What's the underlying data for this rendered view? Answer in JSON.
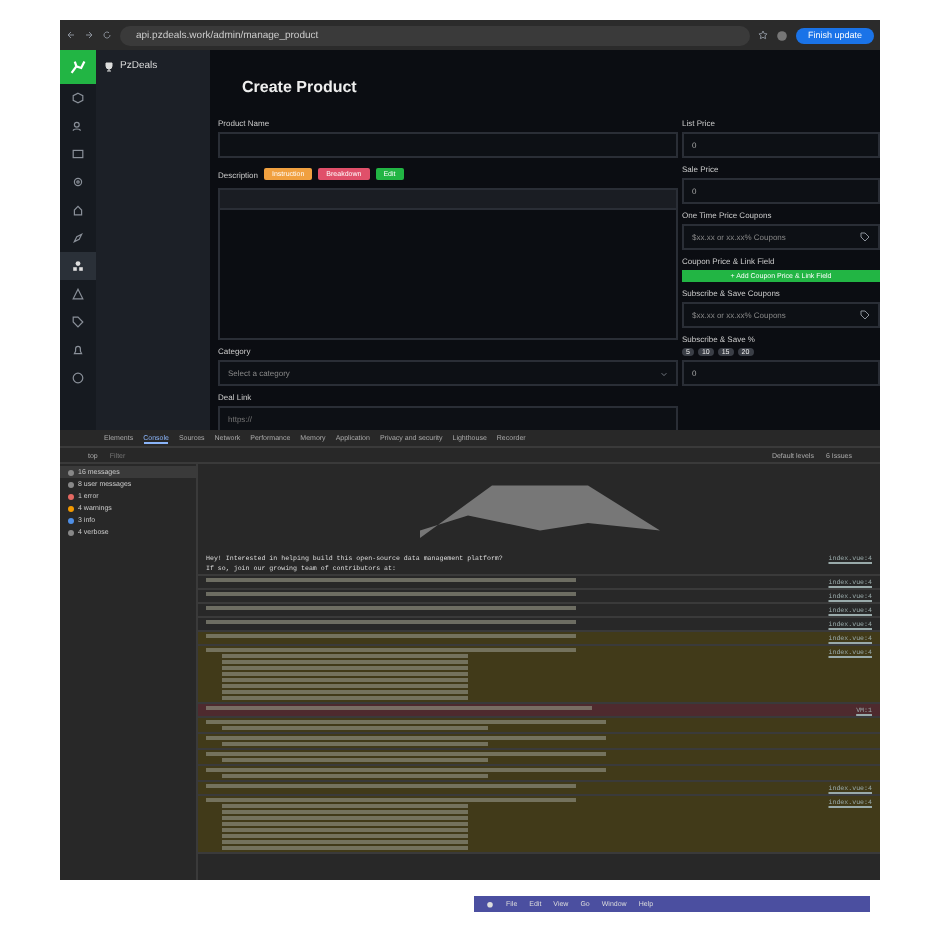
{
  "browser": {
    "url": "api.pzdeals.work/admin/manage_product",
    "update_button": "Finish update"
  },
  "rail": [
    {
      "kind": "box",
      "selected": false
    },
    {
      "kind": "users",
      "selected": false
    },
    {
      "kind": "folder",
      "selected": false
    },
    {
      "kind": "gear",
      "selected": false
    },
    {
      "kind": "home",
      "selected": false
    },
    {
      "kind": "rocket",
      "selected": false
    },
    {
      "kind": "shapes",
      "selected": true
    },
    {
      "kind": "warning",
      "selected": false
    },
    {
      "kind": "tag",
      "selected": false
    },
    {
      "kind": "bell",
      "selected": false
    },
    {
      "kind": "circle",
      "selected": false
    }
  ],
  "sidebar": {
    "brand": "PzDeals"
  },
  "page_title": "Create Product",
  "left_fields": {
    "product_name": {
      "label": "Product Name"
    },
    "description": {
      "label": "Description",
      "buttons": [
        {
          "label": "Instruction",
          "color": "#f0a040"
        },
        {
          "label": "Breakdown",
          "color": "#e0506a"
        },
        {
          "label": "Edit",
          "color": "#22b544"
        }
      ]
    },
    "category": {
      "label": "Category",
      "placeholder": "Select a category"
    },
    "deal_link": {
      "label": "Deal Link",
      "placeholder": "https://"
    }
  },
  "right_fields": [
    {
      "kind": "input",
      "label": "List Price",
      "value": "0"
    },
    {
      "kind": "input",
      "label": "Sale Price",
      "value": "0"
    },
    {
      "kind": "coupon",
      "label": "One Time Price Coupons",
      "placeholder": "$xx.xx or xx.xx% Coupons"
    },
    {
      "kind": "button",
      "label": "Coupon Price & Link Field",
      "button": "+ Add Coupon Price & Link Field"
    },
    {
      "kind": "coupon",
      "label": "Subscribe & Save Coupons",
      "placeholder": "$xx.xx or xx.xx% Coupons"
    },
    {
      "kind": "chips",
      "label": "Subscribe & Save %",
      "chips": [
        "5",
        "10",
        "15",
        "20"
      ]
    },
    {
      "kind": "input",
      "value": "0"
    }
  ],
  "devtools": {
    "tabs": [
      {
        "label": "Elements",
        "selected": false
      },
      {
        "label": "Console",
        "selected": true
      },
      {
        "label": "Sources",
        "selected": false
      },
      {
        "label": "Network",
        "selected": false
      },
      {
        "label": "Performance",
        "selected": false
      },
      {
        "label": "Memory",
        "selected": false
      },
      {
        "label": "Application",
        "selected": false
      },
      {
        "label": "Privacy and security",
        "selected": false
      },
      {
        "label": "Lighthouse",
        "selected": false
      },
      {
        "label": "Recorder",
        "selected": false
      }
    ],
    "context": "top",
    "filter_placeholder": "Filter",
    "levels": "Default levels",
    "issues": "6 Issues",
    "sidebar": [
      {
        "kind": "all",
        "label": "16 messages",
        "selected": true
      },
      {
        "kind": "user",
        "label": "8 user messages",
        "selected": false
      },
      {
        "kind": "error",
        "label": "1 error",
        "selected": false
      },
      {
        "kind": "warning",
        "label": "4 warnings",
        "selected": false
      },
      {
        "kind": "info",
        "label": "3 info",
        "selected": false
      },
      {
        "kind": "verbose",
        "label": "4 verbose",
        "selected": false
      }
    ],
    "messages": [
      {
        "kind": "log",
        "text": "Hey! Interested in helping build this open-source data management platform?",
        "text2": "If so, join our growing team of contributors at:",
        "source": "index.vue:4"
      },
      {
        "kind": "log",
        "source": "index.vue:4"
      },
      {
        "kind": "log",
        "source": "index.vue:4"
      },
      {
        "kind": "log",
        "source": "index.vue:4"
      },
      {
        "kind": "log",
        "source": "index.vue:4"
      },
      {
        "kind": "warning",
        "source": "index.vue:4"
      },
      {
        "kind": "trace",
        "source": "index.vue:4"
      },
      {
        "kind": "error",
        "source": "VM:1"
      },
      {
        "kind": "violation"
      },
      {
        "kind": "violation"
      },
      {
        "kind": "violation"
      },
      {
        "kind": "violation"
      },
      {
        "kind": "warning",
        "source": "index.vue:4"
      },
      {
        "kind": "trace",
        "source": "index.vue:4"
      }
    ]
  },
  "menubar": [
    "File",
    "Edit",
    "View",
    "Go",
    "Window",
    "Help"
  ]
}
